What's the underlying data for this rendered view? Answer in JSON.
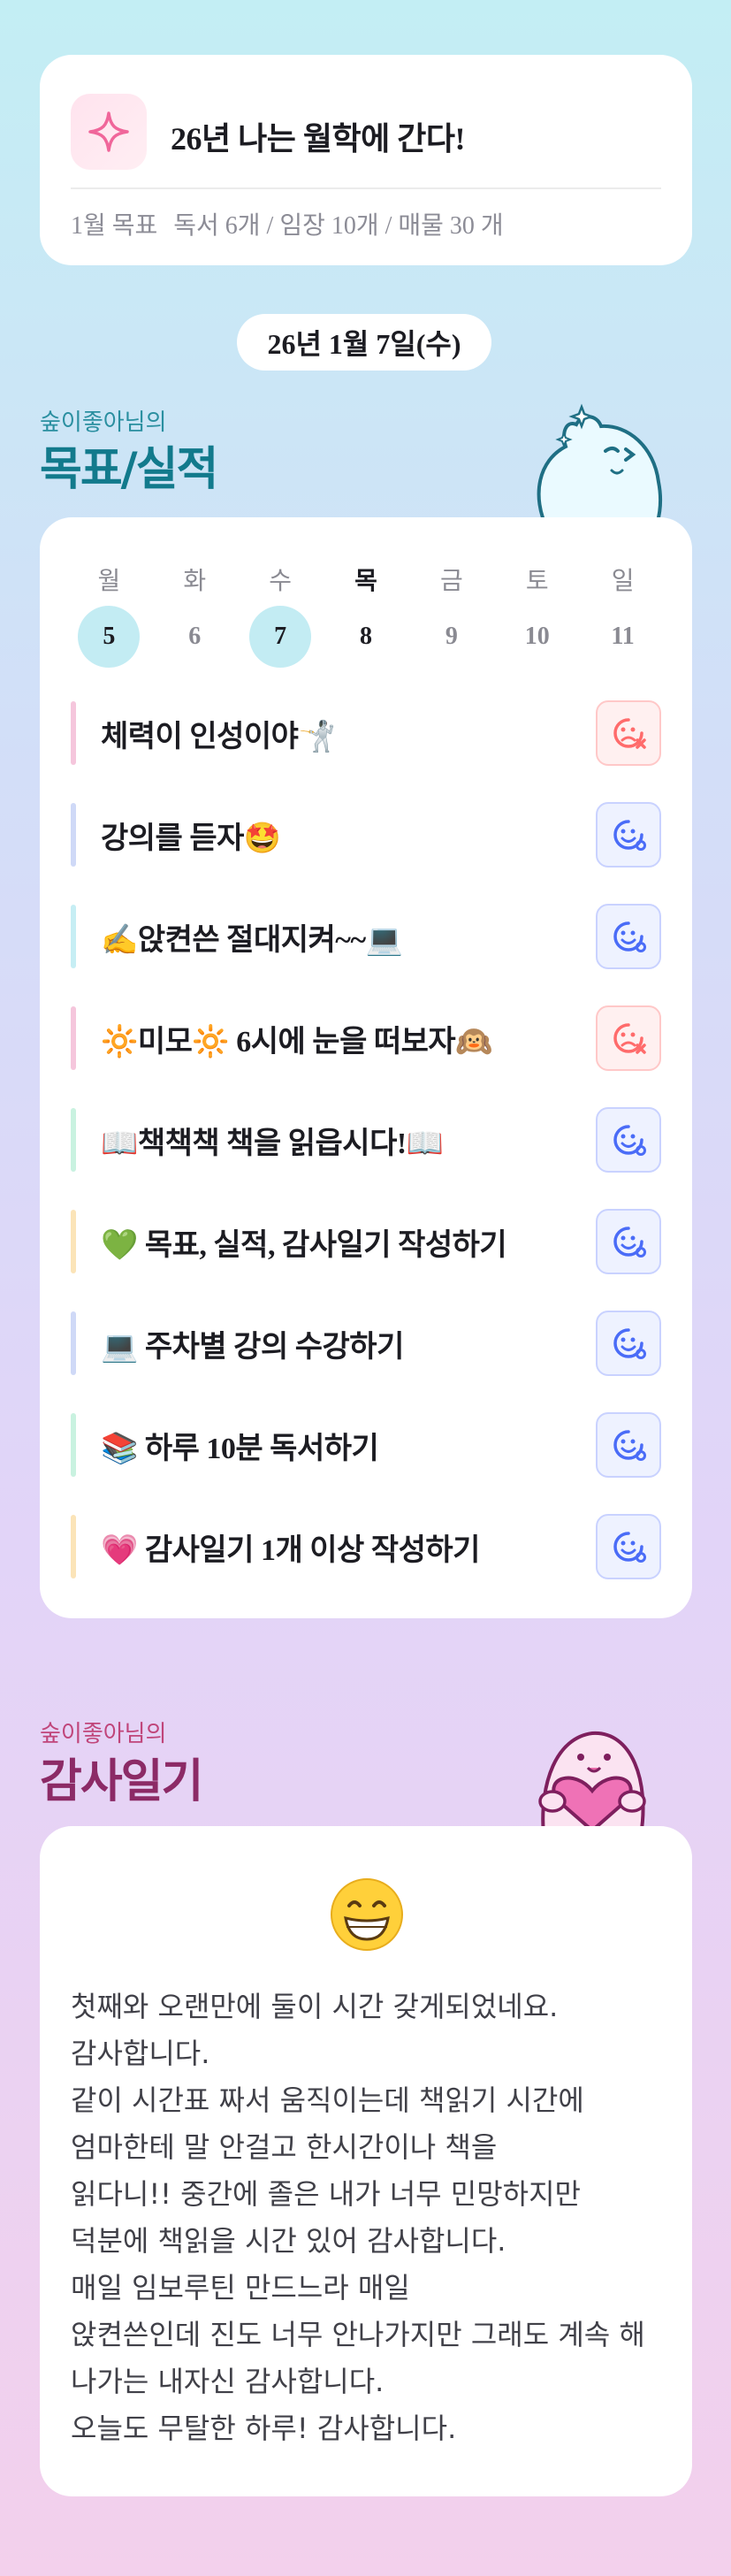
{
  "goal": {
    "title": "26년 나는 월학에 간다!",
    "label": "1월 목표",
    "detail": "독서 6개 / 임장 10개 / 매물 30 개"
  },
  "date": "26년 1월 7일(수)",
  "goals_section": {
    "subtitle": "숲이좋아님의",
    "title": "목표/실적"
  },
  "week": {
    "days": [
      "월",
      "화",
      "수",
      "목",
      "금",
      "토",
      "일"
    ],
    "dates": [
      "5",
      "6",
      "7",
      "8",
      "9",
      "10",
      "11"
    ]
  },
  "tasks": [
    {
      "text": "체력이 인성이야🤺",
      "status": "fail",
      "color": "#f5c6dc"
    },
    {
      "text": "강의를 듣자🤩",
      "status": "ok",
      "color": "#cfd9f7"
    },
    {
      "text": "✍️앉켠쓴 절대지켜~~💻",
      "status": "ok",
      "color": "#c6eef4"
    },
    {
      "text": "🔆미모🔆 6시에 눈을 떠보자🙉",
      "status": "fail",
      "color": "#f5c6dc"
    },
    {
      "text": "📖책책책 책을 읽읍시다!📖",
      "status": "ok",
      "color": "#c9f2e0"
    },
    {
      "text": "💚 목표, 실적, 감사일기 작성하기",
      "status": "ok",
      "color": "#fbe4b8"
    },
    {
      "text": "💻 주차별 강의 수강하기",
      "status": "ok",
      "color": "#cfd9f7"
    },
    {
      "text": "📚 하루 10분 독서하기",
      "status": "ok",
      "color": "#c9f2e0"
    },
    {
      "text": "💗 감사일기 1개 이상 작성하기",
      "status": "ok",
      "color": "#fbe4b8"
    }
  ],
  "diary_section": {
    "subtitle": "숲이좋아님의",
    "title": "감사일기"
  },
  "diary": {
    "emoji": "grinning-face",
    "text": "첫째와 오랜만에 둘이 시간 갖게되었네요.\n감사합니다.\n같이 시간표 짜서 움직이는데 책읽기 시간에\n엄마한테 말 안걸고 한시간이나 책을\n읽다니!! 중간에 졸은 내가 너무 민망하지만\n덕분에 책읽을 시간 있어 감사합니다.\n매일 임보루틴 만드느라 매일\n앉켠쓴인데 진도 너무 안나가지만 그래도 계속 해\n나가는 내자신 감사합니다.\n오늘도 무탈한 하루! 감사합니다."
  },
  "colors": {
    "fail": "#ff6b6b",
    "ok": "#4a6cf7",
    "done_day": "#c3ecf3"
  }
}
